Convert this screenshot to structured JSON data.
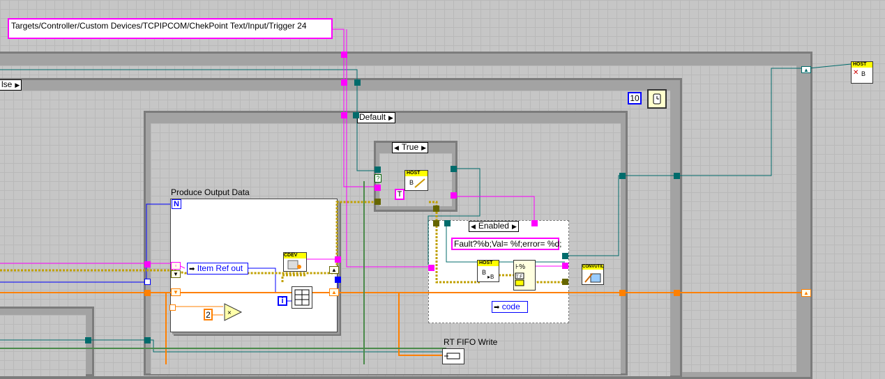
{
  "path_constant": "Targets/Controller/Custom Devices/TCPIPCOM/ChekPoint Text/Input/Trigger 24",
  "outer_case_selector": "lse",
  "inner_case_selector": "Default",
  "true_case_selector": "True",
  "enabled_case_selector": "Enabled",
  "for_loop_label": "Produce Output Data",
  "for_loop_count_terminal": "N",
  "iteration_terminal": "i",
  "item_ref_out": "Item Ref out",
  "numeric_constant_2": "2",
  "wait_ms_constant": "10",
  "format_string": "Fault?%b;Val= %f;error= %d;",
  "code_label": "code",
  "rt_fifo_label": "RT FIFO Write",
  "true_constant": "T",
  "host_tag": "HOST",
  "cdev_tag": "CDEV",
  "convutil_tag": "CONVUTIL",
  "colors": {
    "pink": "#ff00ff",
    "teal": "#006b6b",
    "orange": "#ff8000",
    "blue": "#0000ff",
    "boolean": "#006400",
    "errorwire": "#c0a000"
  }
}
